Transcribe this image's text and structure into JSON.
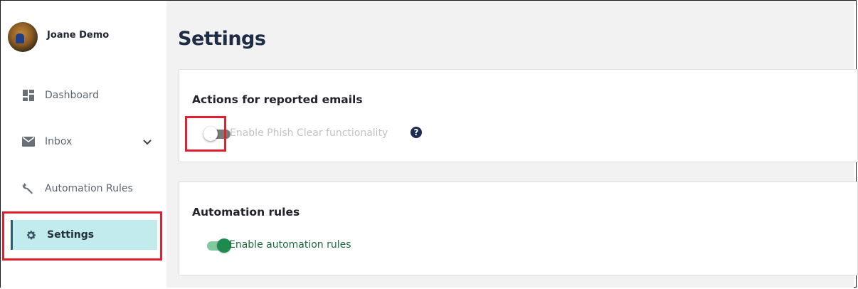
{
  "user": {
    "name": "Joane Demo"
  },
  "sidebar": {
    "items": [
      {
        "label": "Dashboard",
        "icon": "dashboard-icon"
      },
      {
        "label": "Inbox",
        "icon": "mail-icon",
        "has_submenu": true
      },
      {
        "label": "Automation Rules",
        "icon": "wrench-icon"
      },
      {
        "label": "Settings",
        "icon": "gear-icon",
        "active": true
      }
    ]
  },
  "page": {
    "title": "Settings"
  },
  "cards": [
    {
      "title": "Actions for reported emails",
      "toggle_label": "Enable Phish Clear functionality",
      "toggle_state": "off",
      "help_icon": "question-circle-icon",
      "help_glyph": "?"
    },
    {
      "title": "Automation rules",
      "toggle_label": "Enable automation rules",
      "toggle_state": "on"
    }
  ],
  "colors": {
    "highlight_box": "#e0202e",
    "active_nav_bg": "#c2ebee",
    "toggle_on": "#1d8a4e",
    "toggle_on_label": "#1d6b3e",
    "toggle_off_label": "#c3c3c3",
    "title": "#1e2b44"
  }
}
